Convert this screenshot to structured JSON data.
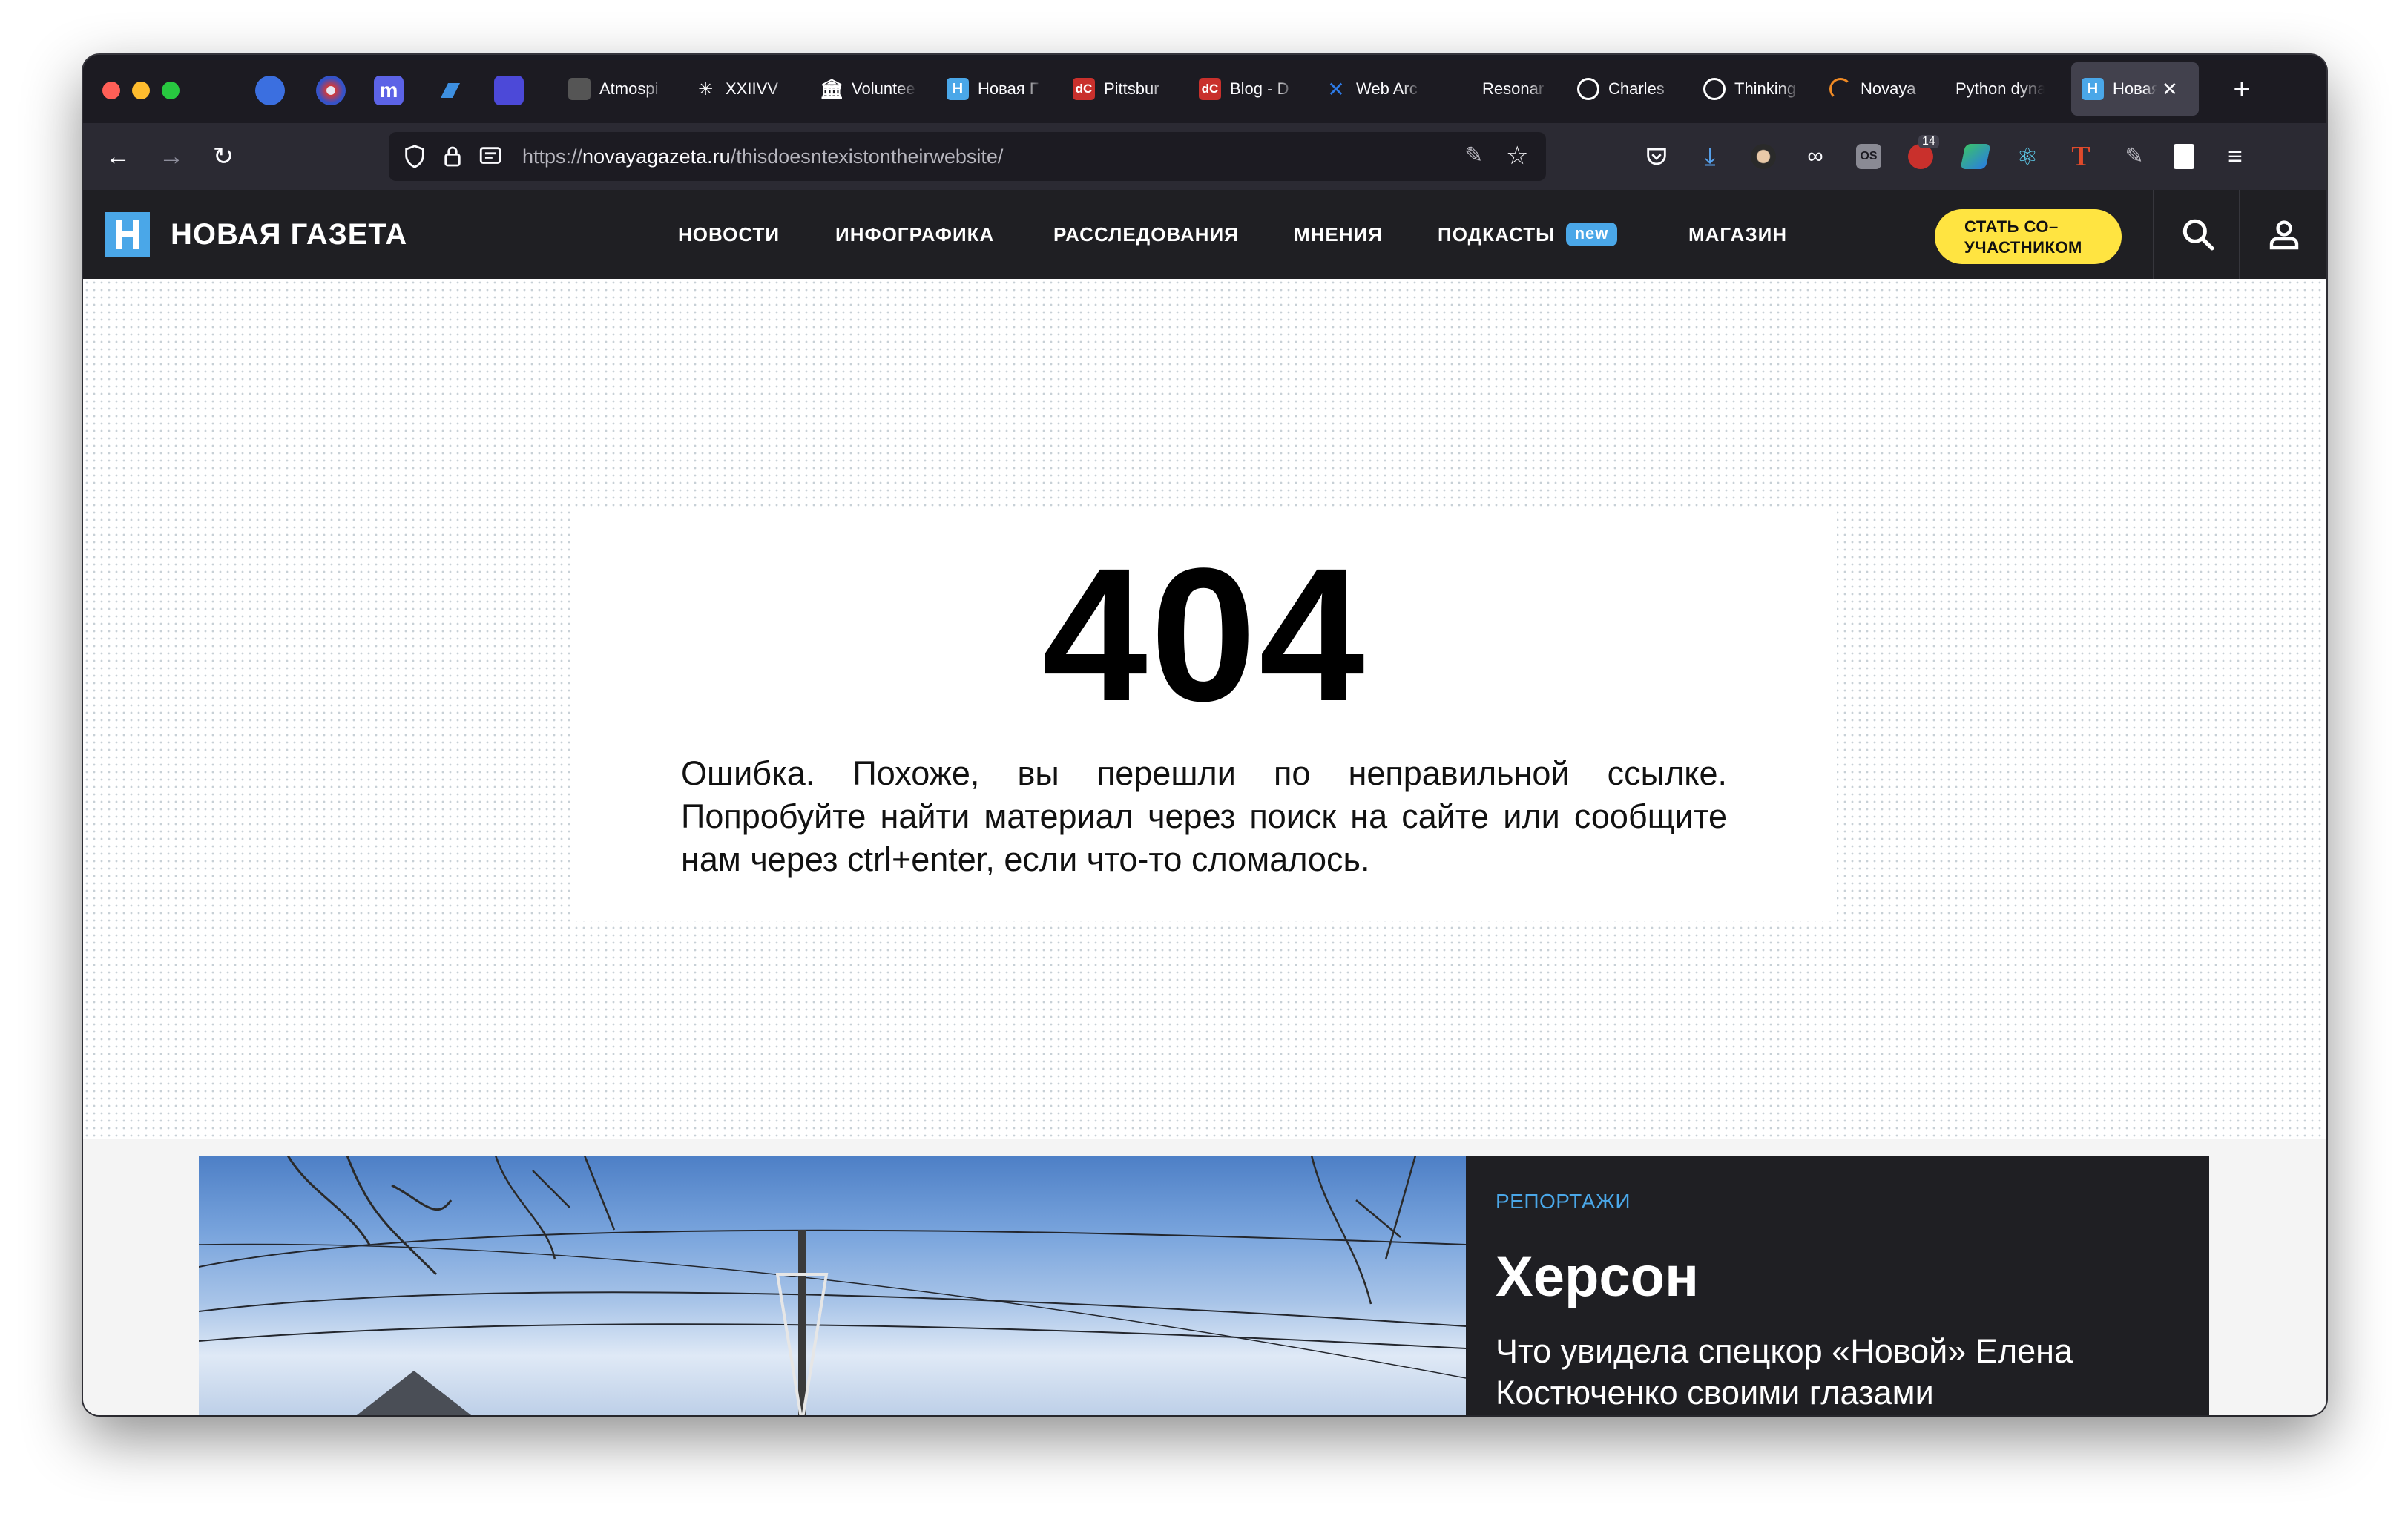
{
  "browser": {
    "tabs": [
      {
        "label": "Atmospi",
        "icon": "website-icon"
      },
      {
        "label": "XXIIVV",
        "icon": "xxiivv-icon"
      },
      {
        "label": "Voluntee",
        "icon": "museum-icon"
      },
      {
        "label": "Новая Г",
        "icon": "novaya-gazeta-icon"
      },
      {
        "label": "Pittsbur",
        "icon": "dc-icon"
      },
      {
        "label": "Blog - D",
        "icon": "dc-icon"
      },
      {
        "label": "Web Arc",
        "icon": "confluence-icon"
      },
      {
        "label": "Resonar",
        "icon": "blank-icon"
      },
      {
        "label": "Charles",
        "icon": "globe-icon"
      },
      {
        "label": "Thinking",
        "icon": "globe-icon"
      },
      {
        "label": "Novaya",
        "icon": "loading-icon"
      },
      {
        "label": "Python dyna",
        "icon": "blank-icon"
      },
      {
        "label": "Новая",
        "icon": "novaya-gazeta-icon",
        "active": true
      }
    ],
    "url": {
      "prefix": "https://",
      "domain": "novayagazeta.ru",
      "path": "/thisdoesntexistontheirwebsite/"
    },
    "ext_badge_count": "14",
    "colors": {
      "chrome_dark": "#1c1b22",
      "toolbar": "#2b2a33",
      "active_tab": "#42414d"
    }
  },
  "site": {
    "brand": "НОВАЯ ГАЗЕТА",
    "logo_letter": "Н",
    "nav": [
      {
        "label": "НОВОСТИ"
      },
      {
        "label": "ИНФОГРАФИКА"
      },
      {
        "label": "РАССЛЕДОВАНИЯ"
      },
      {
        "label": "МНЕНИЯ"
      },
      {
        "label": "ПОДКАСТЫ",
        "badge": "new"
      },
      {
        "label": "МАГАЗИН"
      }
    ],
    "cta_line1": "СТАТЬ СО–",
    "cta_line2": "УЧАСТНИКОМ",
    "colors": {
      "header_bg": "#1f1f23",
      "accent_blue": "#4aa7e8",
      "cta_yellow": "#ffe441"
    }
  },
  "error": {
    "code": "404",
    "message": "Ошибка. Похоже, вы перешли по неправильной ссылке. Попробуйте найти материал через поиск на сайте или сообщите нам через ctrl+enter, если что-то сломалось."
  },
  "teaser": {
    "kicker": "РЕПОРТАЖИ",
    "title": "Херсон",
    "subtitle": "Что увидела спецкор «Новой» Елена Костюченко своими глазами"
  }
}
